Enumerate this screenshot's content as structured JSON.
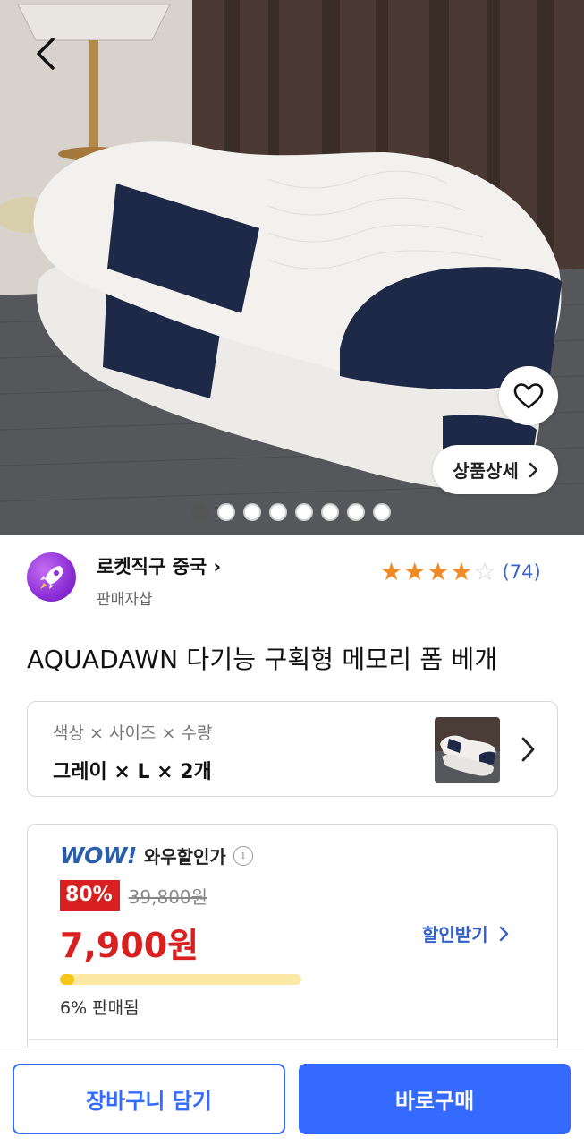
{
  "hero": {
    "detail_button_label": "상품상세",
    "image_count": 8,
    "active_image_index": 0
  },
  "seller": {
    "name": "로켓직구 중국",
    "subtitle": "판매자샵"
  },
  "rating": {
    "stars": 4,
    "max_stars": 5,
    "count_label": "(74)"
  },
  "product": {
    "title": "AQUADAWN 다기능 구획형 메모리 폼 베개"
  },
  "options": {
    "label": "색상 × 사이즈 × 수량",
    "value": "그레이 × L × 2개"
  },
  "price": {
    "wow_logo": "WOW!",
    "wow_label": "와우할인가",
    "discount": "80%",
    "original_price": "39,800원",
    "sale_price": "7,900원",
    "coupon_label": "할인받기",
    "sold_fraction": 0.06,
    "sold_text": "6% 판매됨"
  },
  "actions": {
    "cart_label": "장바구니 담기",
    "buy_label": "바로구매"
  },
  "colors": {
    "accent": "#346aff",
    "price_red": "#d91f1f",
    "star": "#f08a24",
    "wow_blue": "#2b5ea8"
  },
  "icons": [
    "back-arrow-icon",
    "heart-icon",
    "chevron-right-icon",
    "rocket-icon",
    "info-icon",
    "star-icon"
  ]
}
